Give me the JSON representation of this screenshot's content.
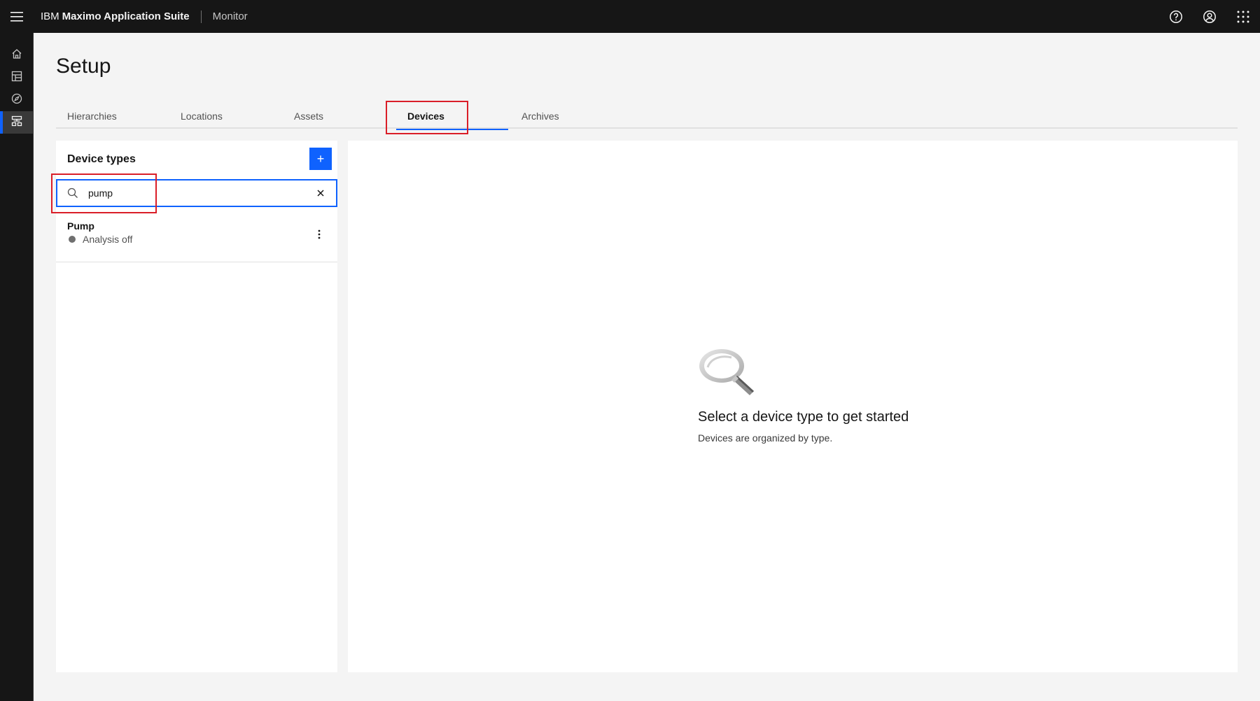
{
  "header": {
    "brand_prefix": "IBM",
    "brand_name": "Maximo Application Suite",
    "app_name": "Monitor",
    "icons": [
      "menu-icon",
      "help-icon",
      "user-avatar-icon",
      "app-switcher-icon"
    ]
  },
  "rail": {
    "items": [
      {
        "icon": "home-icon",
        "active": false
      },
      {
        "icon": "dashboard-icon",
        "active": false
      },
      {
        "icon": "explore-compass-icon",
        "active": false
      },
      {
        "icon": "setup-hierarchy-icon",
        "active": true
      }
    ]
  },
  "page": {
    "title": "Setup"
  },
  "tabs": [
    {
      "label": "Hierarchies",
      "active": false
    },
    {
      "label": "Locations",
      "active": false
    },
    {
      "label": "Assets",
      "active": false
    },
    {
      "label": "Devices",
      "active": true
    },
    {
      "label": "Archives",
      "active": false
    }
  ],
  "device_types": {
    "title": "Device types",
    "add_label": "+",
    "search": {
      "value": "pump",
      "placeholder": ""
    },
    "items": [
      {
        "name": "Pump",
        "status": "Analysis off"
      }
    ]
  },
  "empty_state": {
    "title": "Select a device type to get started",
    "subtitle": "Devices are organized by type."
  },
  "colors": {
    "header_bg": "#161616",
    "accent": "#0f62fe",
    "highlight": "#da1e28",
    "status_off": "#6f6f6f"
  }
}
